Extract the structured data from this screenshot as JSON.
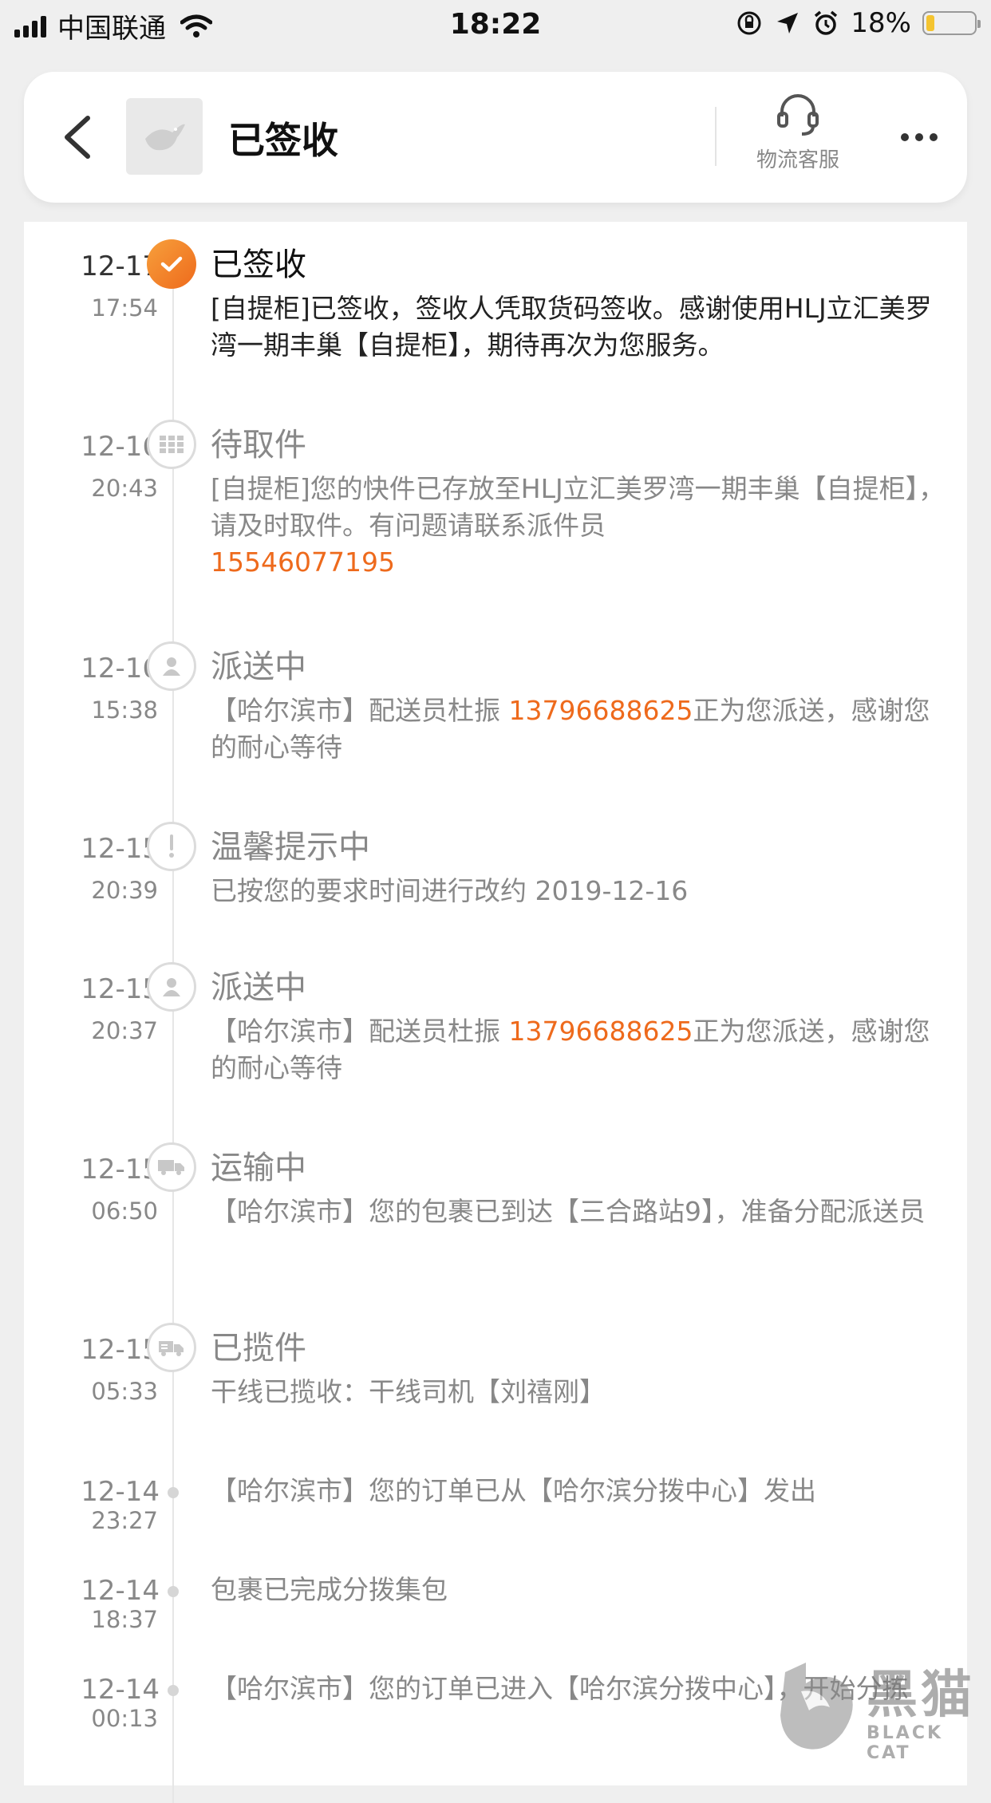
{
  "status_bar": {
    "carrier": "中国联通",
    "time": "18:22",
    "battery_percent_label": "18%",
    "battery_level": 0.18,
    "icons": [
      "signal-icon",
      "wifi-icon",
      "orientation-lock-icon",
      "location-icon",
      "alarm-icon",
      "battery-icon"
    ]
  },
  "header": {
    "title": "已签收",
    "service_label": "物流客服",
    "icons": [
      "back-icon",
      "store-logo-icon",
      "headset-icon",
      "more-icon"
    ]
  },
  "timeline": [
    {
      "date": "12-17",
      "time": "17:54",
      "status": "已签收",
      "icon": "check-icon",
      "active": true,
      "text": "[自提柜]已签收，签收人凭取货码签收。感谢使用HLJ立汇美罗湾一期丰巢【自提柜】，期待再次为您服务。"
    },
    {
      "date": "12-16",
      "time": "20:43",
      "status": "待取件",
      "icon": "locker-icon",
      "active": false,
      "text": "[自提柜]您的快件已存放至HLJ立汇美罗湾一期丰巢【自提柜】，请及时取件。有问题请联系派件员",
      "phone": "15546077195"
    },
    {
      "date": "12-16",
      "time": "15:38",
      "status": "派送中",
      "icon": "courier-icon",
      "active": false,
      "text_before": "【哈尔滨市】配送员杜振 ",
      "phone": "13796688625",
      "text_after": "正为您派送，感谢您的耐心等待"
    },
    {
      "date": "12-15",
      "time": "20:39",
      "status": "温馨提示中",
      "icon": "exclamation-icon",
      "active": false,
      "text": "已按您的要求时间进行改约 2019-12-16"
    },
    {
      "date": "12-15",
      "time": "20:37",
      "status": "派送中",
      "icon": "courier-icon",
      "active": false,
      "text_before": "【哈尔滨市】配送员杜振 ",
      "phone": "13796688625",
      "text_after": "正为您派送，感谢您的耐心等待"
    },
    {
      "date": "12-15",
      "time": "06:50",
      "status": "运输中",
      "icon": "truck-icon",
      "active": false,
      "text": "【哈尔滨市】您的包裹已到达【三合路站9】，准备分配派送员"
    },
    {
      "date": "12-15",
      "time": "05:33",
      "status": "已揽件",
      "icon": "pickup-truck-icon",
      "active": false,
      "text": "干线已揽收：干线司机【刘禧刚】"
    },
    {
      "date": "12-14",
      "time": "23:27",
      "text": "【哈尔滨市】您的订单已从【哈尔滨分拨中心】发出"
    },
    {
      "date": "12-14",
      "time": "18:37",
      "text": "包裹已完成分拨集包"
    },
    {
      "date": "12-14",
      "time": "00:13",
      "text": "【哈尔滨市】您的订单已进入【哈尔滨分拨中心】，开始分拣"
    }
  ],
  "watermark": {
    "brand_cn": "黑猫",
    "brand_en": "BLACK CAT"
  },
  "colors": {
    "accent": "#ee6a1c",
    "muted": "#888888",
    "background": "#efefef"
  }
}
